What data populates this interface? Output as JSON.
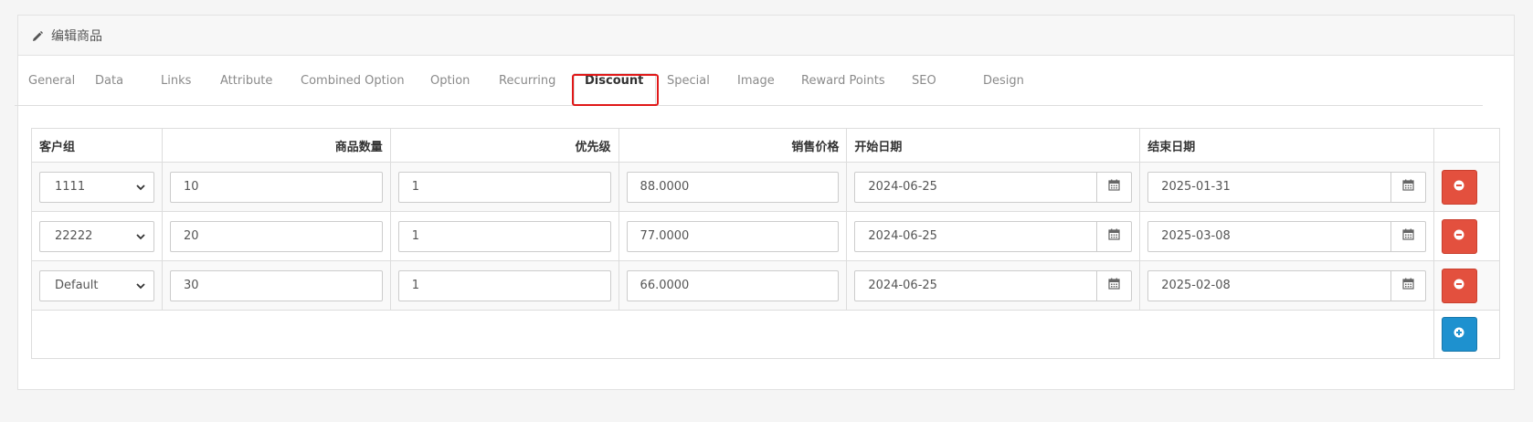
{
  "panel": {
    "title": "编辑商品",
    "icon": "pencil-icon"
  },
  "tabs": [
    {
      "label": "General"
    },
    {
      "label": "Data"
    },
    {
      "label": "Links"
    },
    {
      "label": "Attribute"
    },
    {
      "label": "Combined Option"
    },
    {
      "label": "Option"
    },
    {
      "label": "Recurring"
    },
    {
      "label": "Discount",
      "active": true
    },
    {
      "label": "Special"
    },
    {
      "label": "Image"
    },
    {
      "label": "Reward Points"
    },
    {
      "label": "SEO"
    },
    {
      "label": "Design"
    }
  ],
  "table": {
    "headers": {
      "customer_group": "客户组",
      "quantity": "商品数量",
      "priority": "优先级",
      "price": "销售价格",
      "date_start": "开始日期",
      "date_end": "结束日期"
    },
    "rows": [
      {
        "customer_group": "1111",
        "quantity": "10",
        "priority": "1",
        "price": "88.0000",
        "date_start": "2024-06-25",
        "date_end": "2025-01-31"
      },
      {
        "customer_group": "22222",
        "quantity": "20",
        "priority": "1",
        "price": "77.0000",
        "date_start": "2024-06-25",
        "date_end": "2025-03-08"
      },
      {
        "customer_group": "Default",
        "quantity": "30",
        "priority": "1",
        "price": "66.0000",
        "date_start": "2024-06-25",
        "date_end": "2025-02-08"
      }
    ]
  },
  "colors": {
    "remove_button": "#e3503e",
    "add_button": "#1e91cf",
    "active_tab_highlight": "#e01818"
  }
}
